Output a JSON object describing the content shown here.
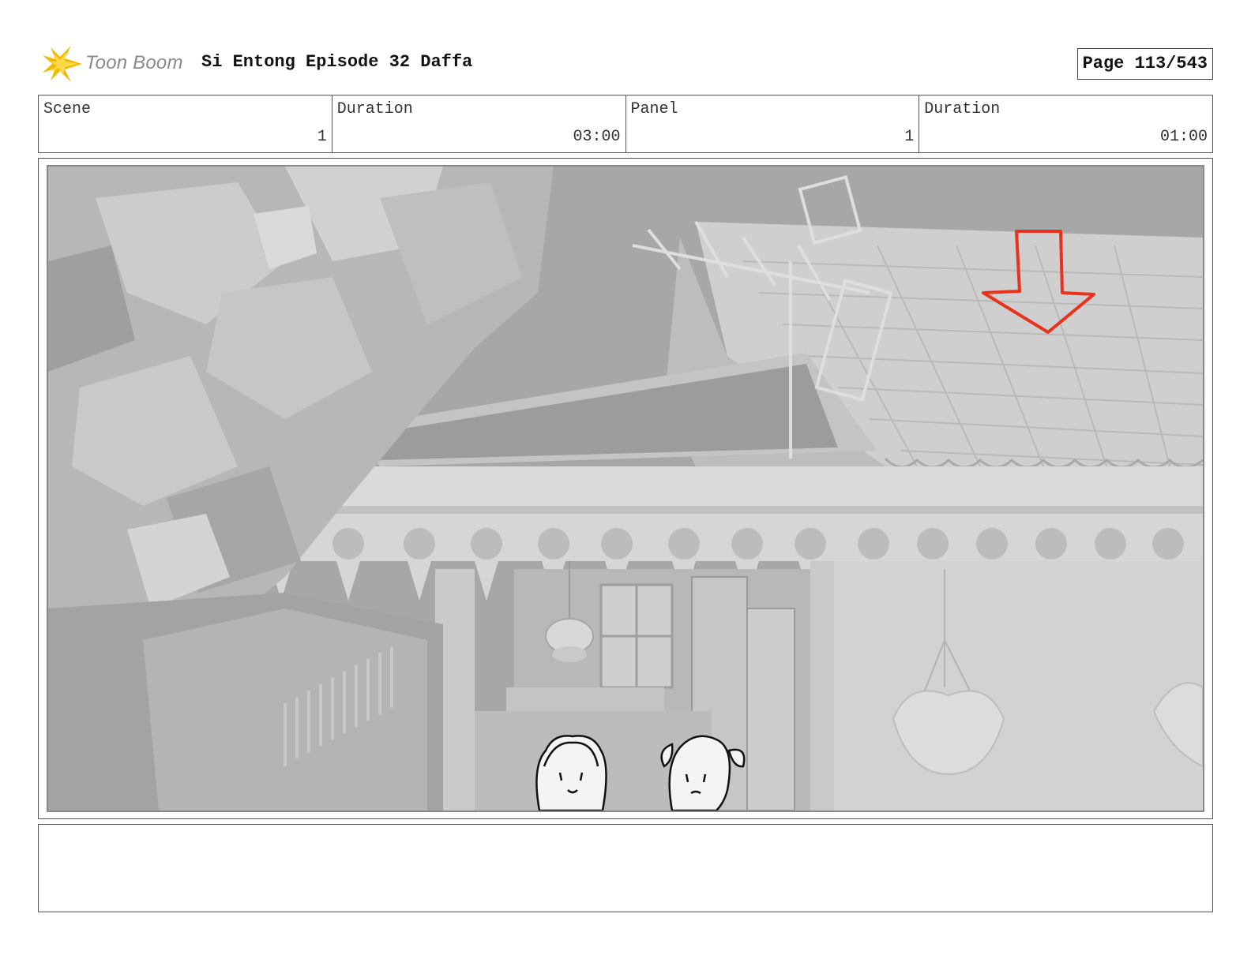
{
  "header": {
    "logo_text": "Toon Boom",
    "title": "Si Entong Episode 32 Daffa",
    "page": "Page 113/543"
  },
  "info": {
    "scene_label": "Scene",
    "scene_value": "1",
    "scene_duration_label": "Duration",
    "scene_duration_value": "03:00",
    "panel_label": "Panel",
    "panel_value": "1",
    "panel_duration_label": "Duration",
    "panel_duration_value": "01:00"
  },
  "panel": {
    "annotation_color": "#e8321e",
    "logo_color": "#f5b800"
  },
  "notes": {
    "text": ""
  }
}
